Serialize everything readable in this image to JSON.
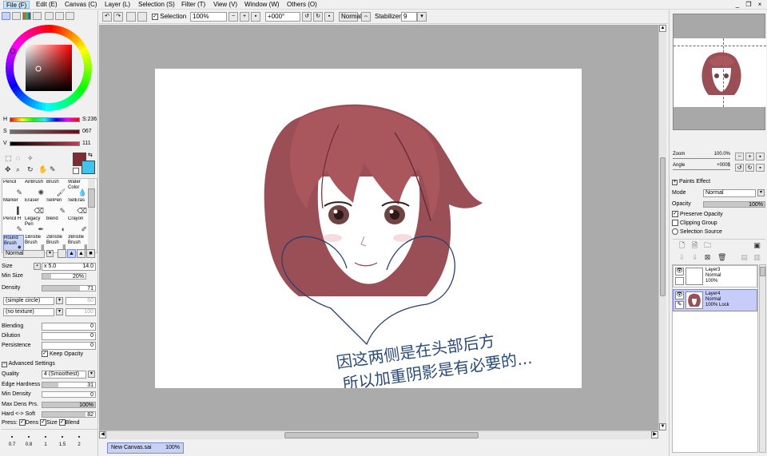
{
  "menu": {
    "items": [
      "File (F)",
      "Edit (E)",
      "Canvas (C)",
      "Layer (L)",
      "Selection (S)",
      "Filter (T)",
      "View (V)",
      "Window (W)",
      "Others (O)"
    ],
    "window_buttons": [
      "_",
      "❐",
      "×"
    ]
  },
  "toolbar": {
    "selection_label": "Selection",
    "zoom": "100%",
    "angle": "+000°",
    "blend_mode": "Normal",
    "stabilizer_label": "Stabilizer",
    "stabilizer_value": "9"
  },
  "color": {
    "h_label": "H",
    "h_value": "S:236",
    "s_label": "S",
    "s_value": "067",
    "v_label": "V",
    "v_value": "111",
    "foreground": "#7a2e34",
    "background": "#3fc4ee"
  },
  "tools": {
    "brushes": [
      {
        "name": "Pencil"
      },
      {
        "name": "AirBrush"
      },
      {
        "name": "Brush"
      },
      {
        "name": "Water Color"
      },
      {
        "name": "Marker"
      },
      {
        "name": "Eraser"
      },
      {
        "name": "SelPen"
      },
      {
        "name": "SelEras"
      },
      {
        "name": "Pencil H"
      },
      {
        "name": "Legacy Pen"
      },
      {
        "name": "blend"
      },
      {
        "name": "Crayon"
      },
      {
        "name": "Round Brush"
      },
      {
        "name": "1Bristle Brush"
      },
      {
        "name": "2Bristle Brush"
      },
      {
        "name": "3Bristle Brush"
      }
    ]
  },
  "brush_settings": {
    "mode": "Normal",
    "size_label": "Size",
    "size_multiplier": "x 5.0",
    "size_value": "14.0",
    "min_size_label": "Min Size",
    "min_size_value": "20%",
    "min_size_fill": 0.2,
    "density_label": "Density",
    "density_value": "71",
    "density_fill": 0.71,
    "shape": "(simple circle)",
    "shape_value": "60",
    "texture": "(no texture)",
    "texture_value": "100",
    "blending_label": "Blending",
    "blending_value": "0",
    "dilution_label": "Dilution",
    "dilution_value": "0",
    "persistence_label": "Persistence",
    "persistence_value": "0",
    "keep_opacity_label": "Keep Opacity",
    "advanced_label": "Advanced Settings",
    "quality_label": "Quality",
    "quality_value": "4 (Smoothest)",
    "edge_hardness_label": "Edge Hardness",
    "edge_hardness_value": "31",
    "edge_hardness_fill": 0.31,
    "min_density_label": "Min Density",
    "min_density_value": "0",
    "max_dens_prs_label": "Max Dens Prs.",
    "max_dens_prs_value": "100%",
    "max_dens_prs_fill": 1.0,
    "hard_soft_label": "Hard <-> Soft",
    "hard_soft_value": "82",
    "hard_soft_fill": 0.82,
    "press_label": "Press:",
    "dens_label": "Dens",
    "size_chk_label": "Size",
    "blend_chk_label": "Blend",
    "size_presets": [
      "0.7",
      "0.8",
      "1",
      "1.5",
      "2"
    ]
  },
  "navigator": {
    "zoom_label": "Zoom",
    "zoom_value": "100.0%",
    "angle_label": "Angle",
    "angle_value": "+000$"
  },
  "layer_panel": {
    "paints_effect_label": "Paints Effect",
    "mode_label": "Mode",
    "mode_value": "Normal",
    "opacity_label": "Opacity",
    "opacity_value": "100%",
    "preserve_opacity_label": "Preserve Opacity",
    "clipping_group_label": "Clipping Group",
    "selection_source_label": "Selection Source",
    "layers": [
      {
        "name": "Layer3",
        "mode": "Normal",
        "opacity": "100%",
        "selected": false
      },
      {
        "name": "Layer4",
        "mode": "Normal",
        "opacity": "100% Lock",
        "selected": true
      }
    ]
  },
  "status": {
    "document_name": "New Canvas.sai",
    "document_zoom": "100%"
  },
  "canvas": {
    "annotation_line1": "因这两侧是在头部后方",
    "annotation_line2": "所以加重阴影是有必要的..."
  }
}
